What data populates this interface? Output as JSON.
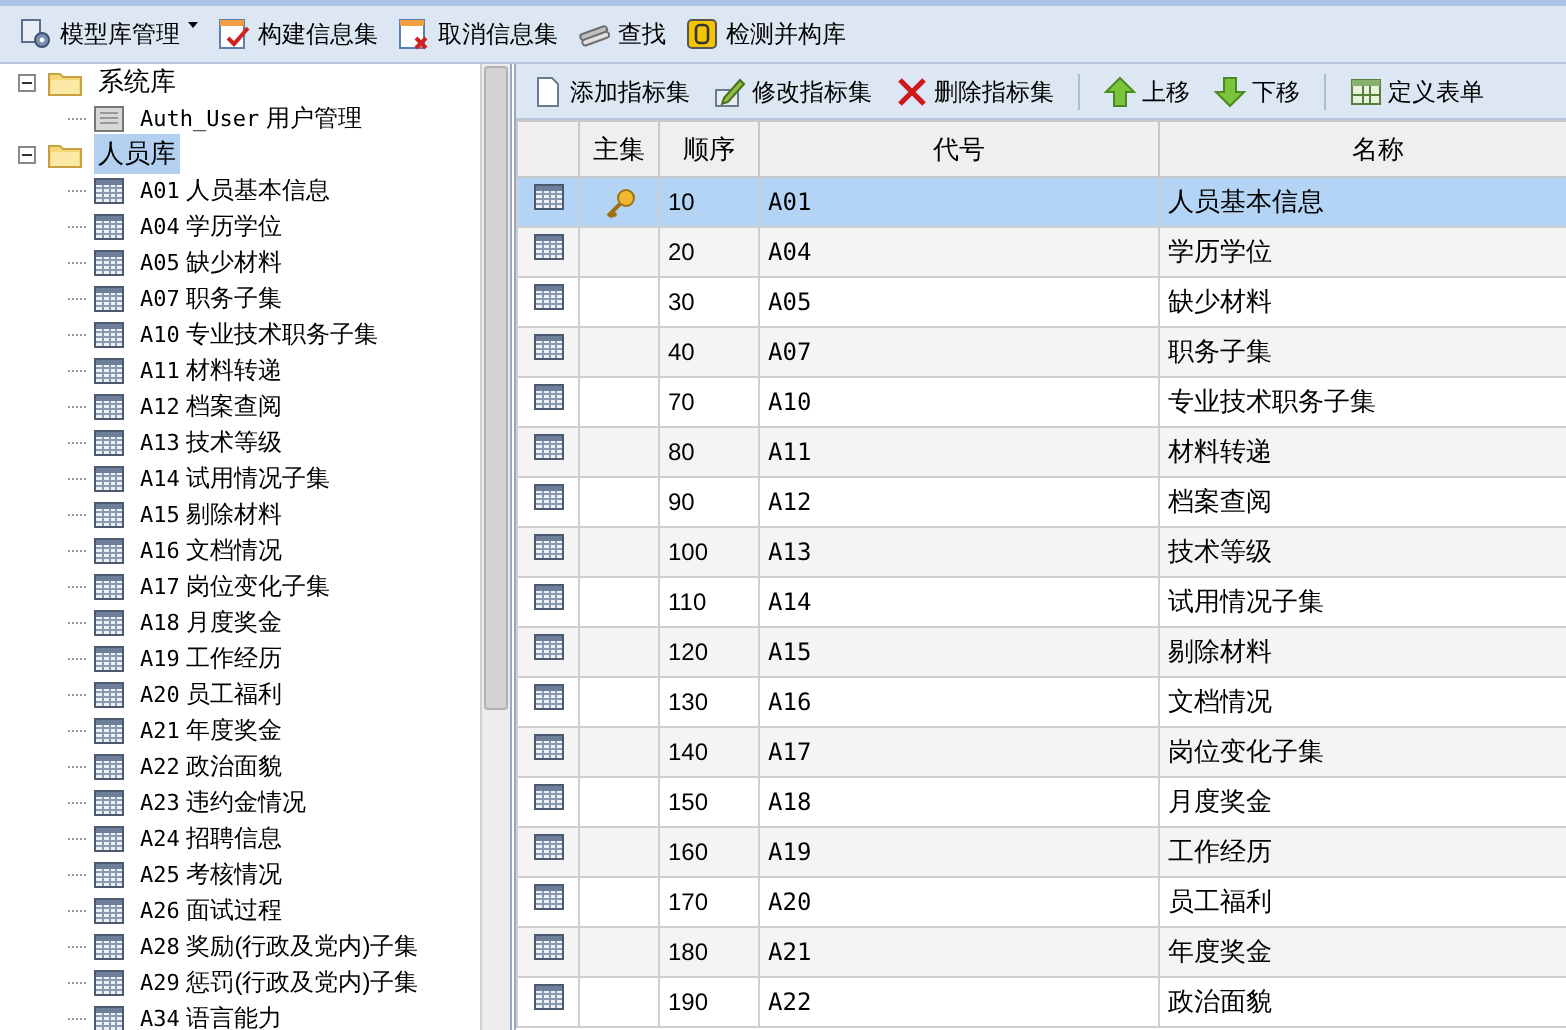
{
  "toolbar": [
    {
      "label": "模型库管理",
      "has_menu": true
    },
    {
      "label": "构建信息集",
      "has_menu": false
    },
    {
      "label": "取消信息集",
      "has_menu": false
    },
    {
      "label": "查找",
      "has_menu": false
    },
    {
      "label": "检测并构库",
      "has_menu": false
    }
  ],
  "tree": [
    {
      "label": "系统库",
      "expanded": true,
      "selected": false,
      "children": [
        {
          "code": "Auth_User",
          "label": "用户管理",
          "kind": "doc"
        }
      ]
    },
    {
      "label": "人员库",
      "expanded": true,
      "selected": true,
      "children": [
        {
          "code": "A01",
          "label": "人员基本信息",
          "kind": "table"
        },
        {
          "code": "A04",
          "label": "学历学位",
          "kind": "table"
        },
        {
          "code": "A05",
          "label": "缺少材料",
          "kind": "table"
        },
        {
          "code": "A07",
          "label": "职务子集",
          "kind": "table"
        },
        {
          "code": "A10",
          "label": "专业技术职务子集",
          "kind": "table"
        },
        {
          "code": "A11",
          "label": "材料转递",
          "kind": "table"
        },
        {
          "code": "A12",
          "label": "档案查阅",
          "kind": "table"
        },
        {
          "code": "A13",
          "label": "技术等级",
          "kind": "table"
        },
        {
          "code": "A14",
          "label": "试用情况子集",
          "kind": "table"
        },
        {
          "code": "A15",
          "label": "剔除材料",
          "kind": "table"
        },
        {
          "code": "A16",
          "label": "文档情况",
          "kind": "table"
        },
        {
          "code": "A17",
          "label": "岗位变化子集",
          "kind": "table"
        },
        {
          "code": "A18",
          "label": "月度奖金",
          "kind": "table"
        },
        {
          "code": "A19",
          "label": "工作经历",
          "kind": "table"
        },
        {
          "code": "A20",
          "label": "员工福利",
          "kind": "table"
        },
        {
          "code": "A21",
          "label": "年度奖金",
          "kind": "table"
        },
        {
          "code": "A22",
          "label": "政治面貌",
          "kind": "table"
        },
        {
          "code": "A23",
          "label": "违约金情况",
          "kind": "table"
        },
        {
          "code": "A24",
          "label": "招聘信息",
          "kind": "table"
        },
        {
          "code": "A25",
          "label": "考核情况",
          "kind": "table"
        },
        {
          "code": "A26",
          "label": "面试过程",
          "kind": "table"
        },
        {
          "code": "A28",
          "label": "奖励(行政及党内)子集",
          "kind": "table"
        },
        {
          "code": "A29",
          "label": "惩罚(行政及党内)子集",
          "kind": "table"
        },
        {
          "code": "A34",
          "label": "语言能力",
          "kind": "table"
        }
      ]
    }
  ],
  "actions": [
    {
      "kind": "button",
      "label": "添加指标集"
    },
    {
      "kind": "button",
      "label": "修改指标集"
    },
    {
      "kind": "button",
      "label": "删除指标集"
    },
    {
      "kind": "separator"
    },
    {
      "kind": "button",
      "label": "上移"
    },
    {
      "kind": "button",
      "label": "下移"
    },
    {
      "kind": "separator"
    },
    {
      "kind": "button",
      "label": "定义表单"
    }
  ],
  "table": {
    "columns": [
      "主集",
      "顺序",
      "代号",
      "名称"
    ],
    "rows": [
      {
        "primary": true,
        "selected": true,
        "order": "10",
        "code": "A01",
        "name": "人员基本信息"
      },
      {
        "primary": false,
        "selected": false,
        "order": "20",
        "code": "A04",
        "name": "学历学位"
      },
      {
        "primary": false,
        "selected": false,
        "order": "30",
        "code": "A05",
        "name": "缺少材料"
      },
      {
        "primary": false,
        "selected": false,
        "order": "40",
        "code": "A07",
        "name": "职务子集"
      },
      {
        "primary": false,
        "selected": false,
        "order": "70",
        "code": "A10",
        "name": "专业技术职务子集"
      },
      {
        "primary": false,
        "selected": false,
        "order": "80",
        "code": "A11",
        "name": "材料转递"
      },
      {
        "primary": false,
        "selected": false,
        "order": "90",
        "code": "A12",
        "name": "档案查阅"
      },
      {
        "primary": false,
        "selected": false,
        "order": "100",
        "code": "A13",
        "name": "技术等级"
      },
      {
        "primary": false,
        "selected": false,
        "order": "110",
        "code": "A14",
        "name": "试用情况子集"
      },
      {
        "primary": false,
        "selected": false,
        "order": "120",
        "code": "A15",
        "name": "剔除材料"
      },
      {
        "primary": false,
        "selected": false,
        "order": "130",
        "code": "A16",
        "name": "文档情况"
      },
      {
        "primary": false,
        "selected": false,
        "order": "140",
        "code": "A17",
        "name": "岗位变化子集"
      },
      {
        "primary": false,
        "selected": false,
        "order": "150",
        "code": "A18",
        "name": "月度奖金"
      },
      {
        "primary": false,
        "selected": false,
        "order": "160",
        "code": "A19",
        "name": "工作经历"
      },
      {
        "primary": false,
        "selected": false,
        "order": "170",
        "code": "A20",
        "name": "员工福利"
      },
      {
        "primary": false,
        "selected": false,
        "order": "180",
        "code": "A21",
        "name": "年度奖金"
      },
      {
        "primary": false,
        "selected": false,
        "order": "190",
        "code": "A22",
        "name": "政治面貌"
      }
    ]
  }
}
